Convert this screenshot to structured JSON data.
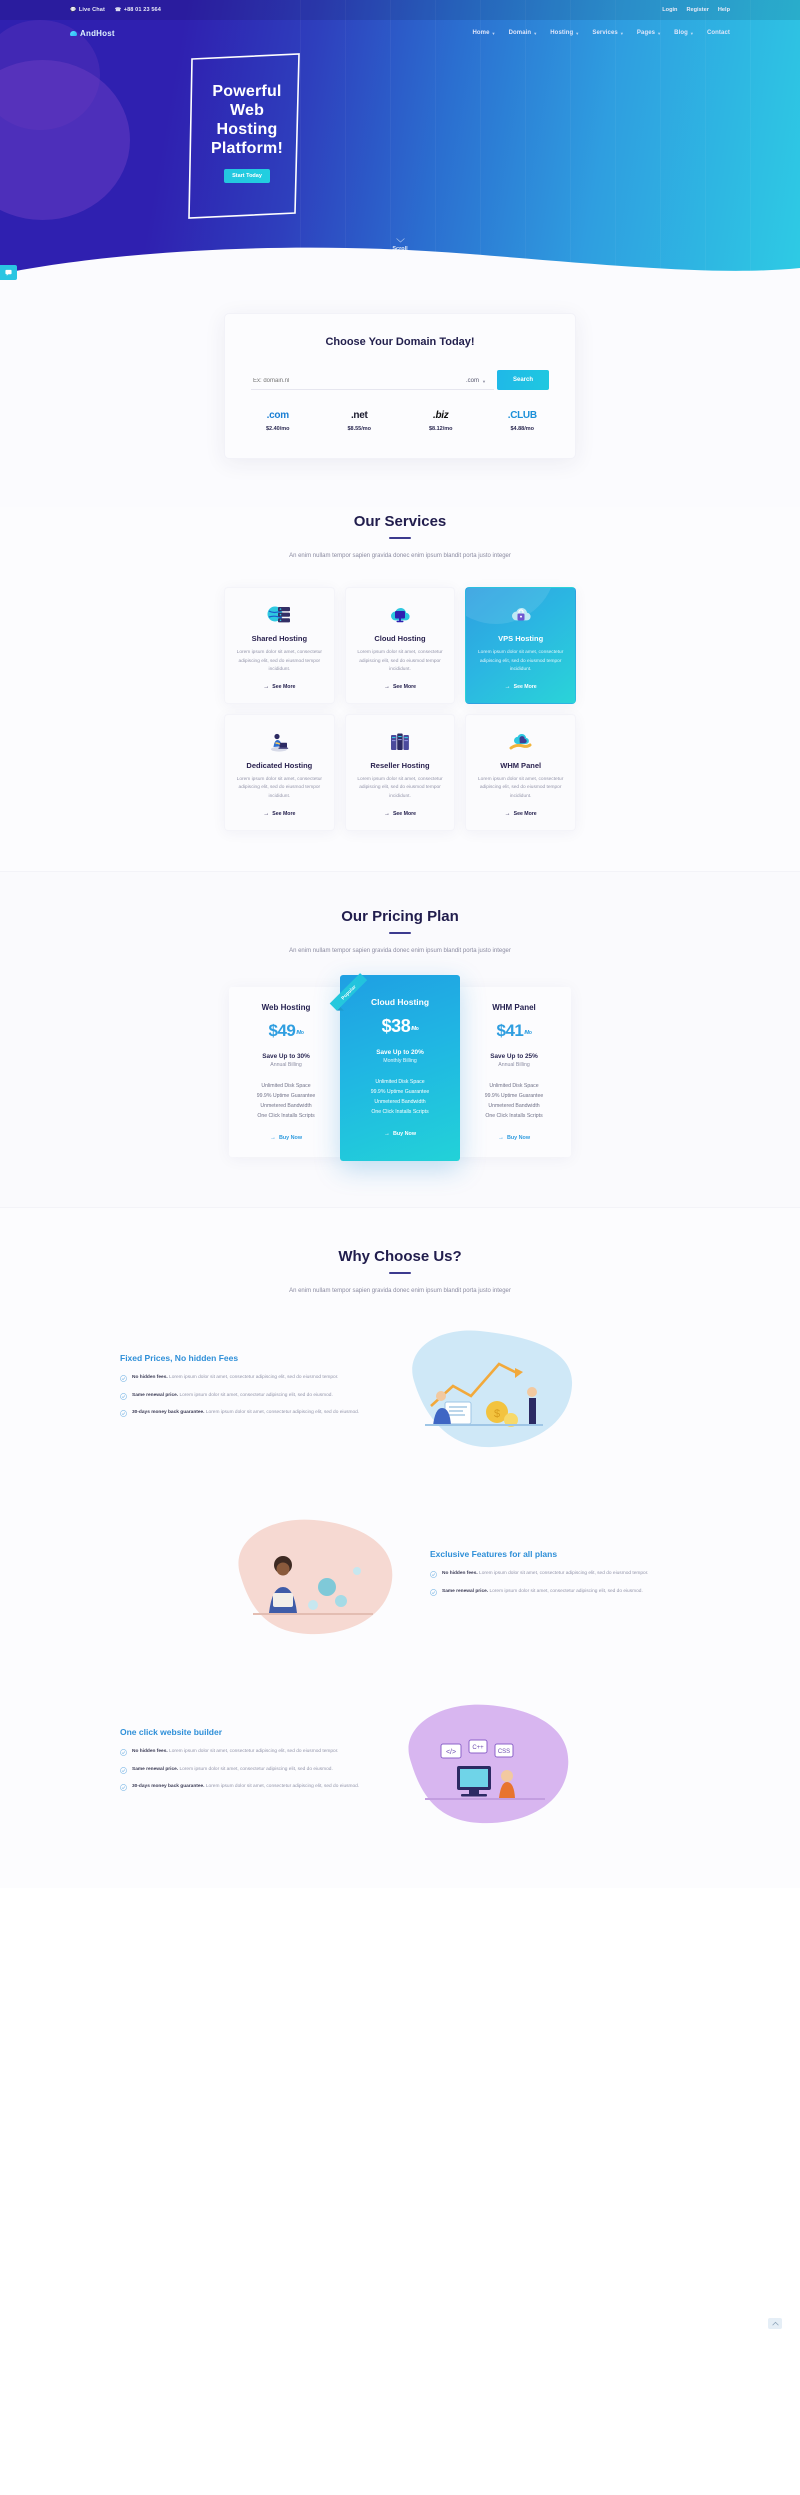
{
  "topbar": {
    "live_chat": "Live Chat",
    "live_chat_icon": "chat-icon",
    "phone": "+88 01 23 564",
    "phone_icon": "phone-icon",
    "login": "Login",
    "register": "Register",
    "help": "Help"
  },
  "nav": {
    "brand": "AndHost",
    "links": [
      {
        "label": "Home",
        "has_caret": true
      },
      {
        "label": "Domain",
        "has_caret": true
      },
      {
        "label": "Hosting",
        "has_caret": true
      },
      {
        "label": "Services",
        "has_caret": true
      },
      {
        "label": "Pages",
        "has_caret": true
      },
      {
        "label": "Blog",
        "has_caret": true
      },
      {
        "label": "Contact",
        "has_caret": false
      }
    ]
  },
  "hero": {
    "line1": "Powerful",
    "line2": "Web",
    "line3": "Hosting",
    "line4": "Platform!",
    "cta": "Start Today",
    "scroll": "Scroll"
  },
  "domain": {
    "title": "Choose Your Domain Today!",
    "placeholder": "Ex: domain.nl",
    "tld_selected": ".com",
    "search_label": "Search",
    "tlds": [
      {
        "name": ".com",
        "price": "$2.40/mo"
      },
      {
        "name": ".net",
        "price": "$8.55/mo"
      },
      {
        "name": ".biz",
        "price": "$8.12/mo"
      },
      {
        "name": ".CLUB",
        "price": "$4.88/mo"
      }
    ]
  },
  "services": {
    "title": "Our Services",
    "subtitle": "An enim nullam tempor sapien gravida donec enim ipsum blandit porta justo integer",
    "more_label": "See More",
    "cards": [
      {
        "name": "Shared Hosting",
        "desc": "Lorem ipsum dolor sit amet, consectetur adipiscing elit, sed do eiusmod tempor incididunt.",
        "icon": "server-globe-icon",
        "featured": false
      },
      {
        "name": "Cloud Hosting",
        "desc": "Lorem ipsum dolor sit amet, consectetur adipiscing elit, sed do eiusmod tempor incididunt.",
        "icon": "cloud-monitor-icon",
        "featured": false
      },
      {
        "name": "VPS Hosting",
        "desc": "Lorem ipsum dolor sit amet, consectetur adipiscing elit, sed do eiusmod tempor incididunt.",
        "icon": "cloud-lock-icon",
        "featured": true
      },
      {
        "name": "Dedicated Hosting",
        "desc": "Lorem ipsum dolor sit amet, consectetur adipiscing elit, sed do eiusmod tempor incididunt.",
        "icon": "person-laptop-icon",
        "featured": false
      },
      {
        "name": "Reseller Hosting",
        "desc": "Lorem ipsum dolor sit amet, consectetur adipiscing elit, sed do eiusmod tempor incididunt.",
        "icon": "server-rack-icon",
        "featured": false
      },
      {
        "name": "WHM Panel",
        "desc": "Lorem ipsum dolor sit amet, consectetur adipiscing elit, sed do eiusmod tempor incididunt.",
        "icon": "cloud-hand-icon",
        "featured": false
      }
    ]
  },
  "pricing": {
    "title": "Our Pricing Plan",
    "subtitle": "An enim nullam tempor sapien gravida donec enim ipsum blandit porta justo integer",
    "popular_badge": "Popular",
    "buy_label": "Buy Now",
    "plans": [
      {
        "name": "Web Hosting",
        "price": "$49",
        "per": "/Mo",
        "save": "Save Up to 30%",
        "cycle": "Annual Billing",
        "features": [
          "Unlimited Disk Space",
          "99.9% Uptime Guarantee",
          "Unmetered Bandwidth",
          "One Click Installs Scripts"
        ],
        "popular": false
      },
      {
        "name": "Cloud Hosting",
        "price": "$38",
        "per": "/Mo",
        "save": "Save Up to 20%",
        "cycle": "Monthly Billing",
        "features": [
          "Unlimited Disk Space",
          "99.9% Uptime Guarantee",
          "Unmetered Bandwidth",
          "One Click Installs Scripts"
        ],
        "popular": true
      },
      {
        "name": "WHM Panel",
        "price": "$41",
        "per": "/Mo",
        "save": "Save Up to 25%",
        "cycle": "Annual Billing",
        "features": [
          "Unlimited Disk Space",
          "99.9% Uptime Guarantee",
          "Unmetered Bandwidth",
          "One Click Installs Scripts"
        ],
        "popular": false
      }
    ]
  },
  "why": {
    "title": "Why Choose Us?",
    "subtitle": "An enim nullam tempor sapien gravida donec enim ipsum blandit porta justo integer",
    "blocks": [
      {
        "heading": "Fixed Prices, No hidden Fees",
        "art": "woman-chart-coins-illustration",
        "items": [
          {
            "lead": "No hidden fees.",
            "text": " Lorem ipsum dolor sit amet, consectetur adipiscing elit, sed do eiusmod tempor."
          },
          {
            "lead": "Same renewal price.",
            "text": " Lorem ipsum dolor sit amet, consectetur adipiscing elit, sed do eiusmod."
          },
          {
            "lead": "30-days money back guarantee.",
            "text": " Lorem ipsum dolor sit amet, consectetur adipiscing elit, sed do eiusmod."
          }
        ]
      },
      {
        "heading": "Exclusive Features for all plans",
        "art": "man-working-illustration",
        "items": [
          {
            "lead": "No hidden fees.",
            "text": " Lorem ipsum dolor sit amet, consectetur adipiscing elit, sed do eiusmod tempor."
          },
          {
            "lead": "Same renewal price.",
            "text": " Lorem ipsum dolor sit amet, consectetur adipiscing elit, sed do eiusmod."
          }
        ]
      },
      {
        "heading": "One click website builder",
        "art": "developer-code-illustration",
        "items": [
          {
            "lead": "No hidden fees.",
            "text": " Lorem ipsum dolor sit amet, consectetur adipiscing elit, sed do eiusmod tempor."
          },
          {
            "lead": "Same renewal price.",
            "text": " Lorem ipsum dolor sit amet, consectetur adipiscing elit, sed do eiusmod."
          },
          {
            "lead": "30-days money back guarantee.",
            "text": " Lorem ipsum dolor sit amet, consectetur adipiscing elit, sed do eiusmod."
          }
        ]
      }
    ]
  },
  "colors": {
    "brand_purple": "#2f20b0",
    "brand_cyan": "#2acde0",
    "accent_blue": "#2e8fd8",
    "dark_text": "#23204d"
  }
}
